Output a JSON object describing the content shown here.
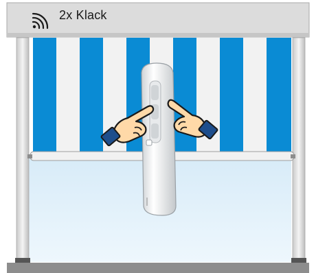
{
  "caption": {
    "text": "2x Klack"
  },
  "icons": {
    "signal": "radio-waves-icon",
    "left_hand": "pointing-hand-left-icon",
    "right_hand": "pointing-hand-right-icon"
  },
  "colors": {
    "frame_gray": "#dcdcdc",
    "stripe_blue": "#0a8bd4",
    "stripe_white": "#f2f2f2",
    "glass": "#e4f1fa",
    "floor": "#8d8d8d",
    "hand_skin": "#ffd9a8",
    "cuff_blue": "#1e4e8c"
  }
}
